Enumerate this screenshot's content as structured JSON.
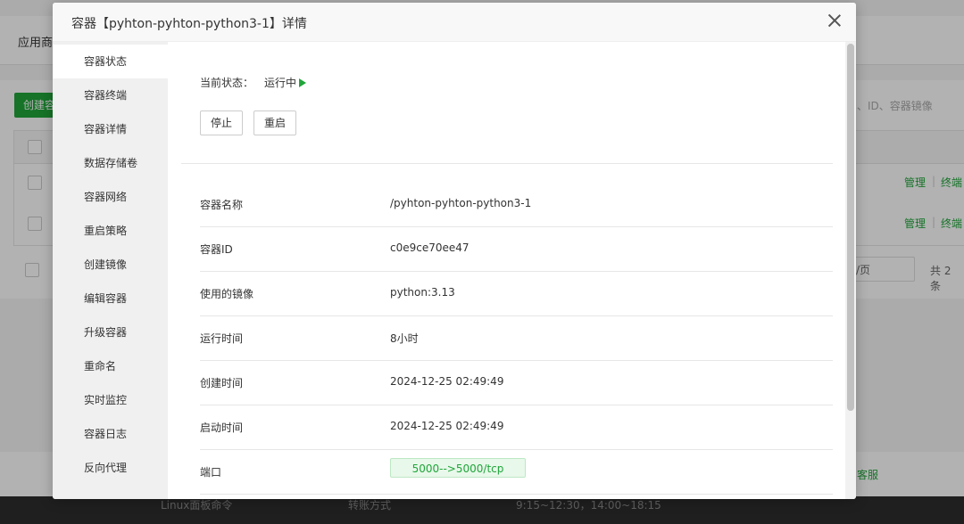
{
  "background": {
    "page_title": "应用商",
    "create_button": "创建容",
    "search_placeholder": "、ID、容器镜像",
    "row_actions": [
      {
        "manage": "管理",
        "sep": "|",
        "terminal": "终端"
      },
      {
        "manage": "管理",
        "sep": "|",
        "terminal": "终端"
      }
    ],
    "page_size": "/页",
    "total": "共 2 条",
    "customer_service": "客服",
    "footer_texts": [
      "Linux面板命令",
      "转账方式",
      "9:15~12:30，14:00~18:15"
    ]
  },
  "modal": {
    "title": "容器【pyhton-pyhton-python3-1】详情",
    "close_icon": "close-icon"
  },
  "side_menu": [
    {
      "label": "容器状态",
      "active": true
    },
    {
      "label": "容器终端"
    },
    {
      "label": "容器详情"
    },
    {
      "label": "数据存储卷"
    },
    {
      "label": "容器网络"
    },
    {
      "label": "重启策略"
    },
    {
      "label": "创建镜像"
    },
    {
      "label": "编辑容器"
    },
    {
      "label": "升级容器"
    },
    {
      "label": "重命名"
    },
    {
      "label": "实时监控"
    },
    {
      "label": "容器日志"
    },
    {
      "label": "反向代理"
    }
  ],
  "status": {
    "label": "当前状态：",
    "value": "运行中",
    "icon": "play-icon",
    "color": "#20a53a"
  },
  "buttons": {
    "stop": "停止",
    "restart": "重启"
  },
  "info": [
    {
      "key": "容器名称",
      "value": "/pyhton-pyhton-python3-1"
    },
    {
      "key": "容器ID",
      "value": "c0e9ce70ee47"
    },
    {
      "key": "使用的镜像",
      "value": "python:3.13"
    },
    {
      "key": "运行时间",
      "value": "8小时"
    },
    {
      "key": "创建时间",
      "value": "2024-12-25 02:49:49"
    },
    {
      "key": "启动时间",
      "value": "2024-12-25 02:49:49"
    },
    {
      "key": "端口",
      "value": "5000-->5000/tcp"
    }
  ],
  "colors": {
    "accent": "#20a53a",
    "port_tag_bg": "#e8f8ea"
  }
}
